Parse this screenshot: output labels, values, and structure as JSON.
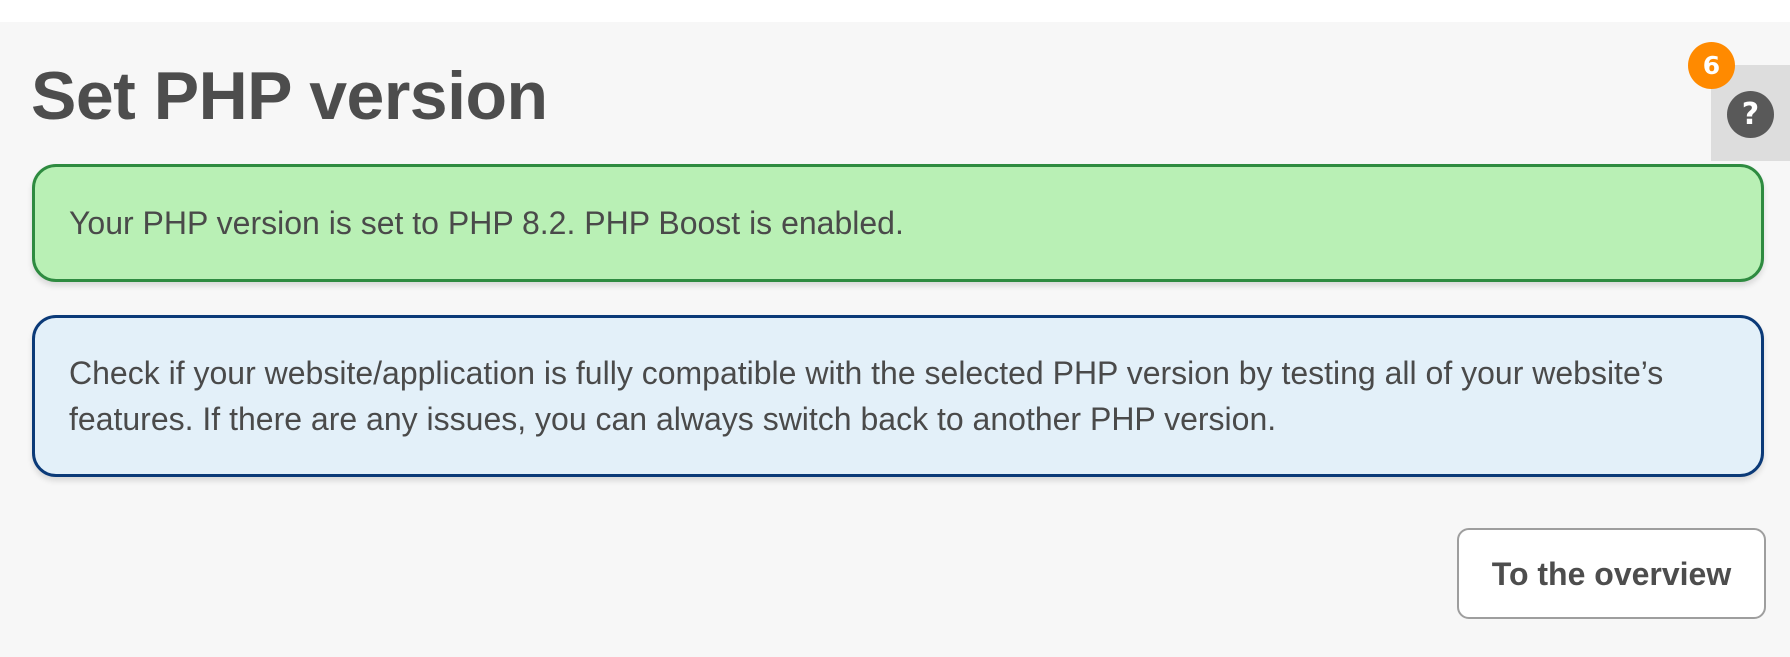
{
  "page": {
    "title": "Set PHP version"
  },
  "help": {
    "icon": "question-mark-icon",
    "glyph": "?",
    "badge_count": "6",
    "badge_color": "#ff8a00"
  },
  "alerts": {
    "success": {
      "text": "Your PHP version is set to PHP 8.2. PHP Boost is enabled.",
      "background": "#b9f0b5",
      "border": "#2e8b40"
    },
    "info": {
      "text": "Check if your website/application is fully compatible with the selected PHP version by testing all of your website’s features. If there are any issues, you can always switch back to another PHP version.",
      "background": "#e3f0f9",
      "border": "#0b3a78"
    }
  },
  "actions": {
    "overview_label": "To the overview"
  }
}
